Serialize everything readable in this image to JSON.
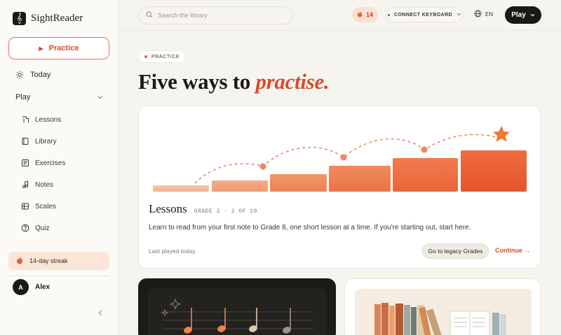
{
  "app": {
    "name": "SightReader",
    "logo_glyph": "𝄞"
  },
  "sidebar": {
    "practice_label": "Practice",
    "today_label": "Today",
    "play_group_label": "Play",
    "items": [
      {
        "label": "Lessons",
        "icon": "lessons-icon"
      },
      {
        "label": "Library",
        "icon": "library-icon"
      },
      {
        "label": "Exercises",
        "icon": "exercises-icon"
      },
      {
        "label": "Notes",
        "icon": "music-note-icon"
      },
      {
        "label": "Scales",
        "icon": "scales-icon"
      },
      {
        "label": "Quiz",
        "icon": "quiz-icon"
      }
    ],
    "streak_label": "14-day streak",
    "user": {
      "initial": "A",
      "name": "Alex"
    }
  },
  "topbar": {
    "search_placeholder": "Search the library",
    "streak_count": "14",
    "connect_label": "CONNECT KEYBOARD",
    "language": "EN",
    "play_label": "Play"
  },
  "main": {
    "tag": "PRACTICE",
    "headline_plain": "Five ways to ",
    "headline_accent": "practise.",
    "lessons_card": {
      "title": "Lessons",
      "meta": "GRADE 2 · 2 OF 19",
      "description": "Learn to read from your first note to Grade 8, one short lesson at a time. If you're starting out, start here.",
      "last_played": "Last played today",
      "legacy_button": "Go to legacy Grades",
      "continue_label": "Continue →"
    }
  },
  "colors": {
    "accent": "#d94b2c",
    "streak_bg": "#fbe5d8",
    "dark": "#1a1816"
  }
}
